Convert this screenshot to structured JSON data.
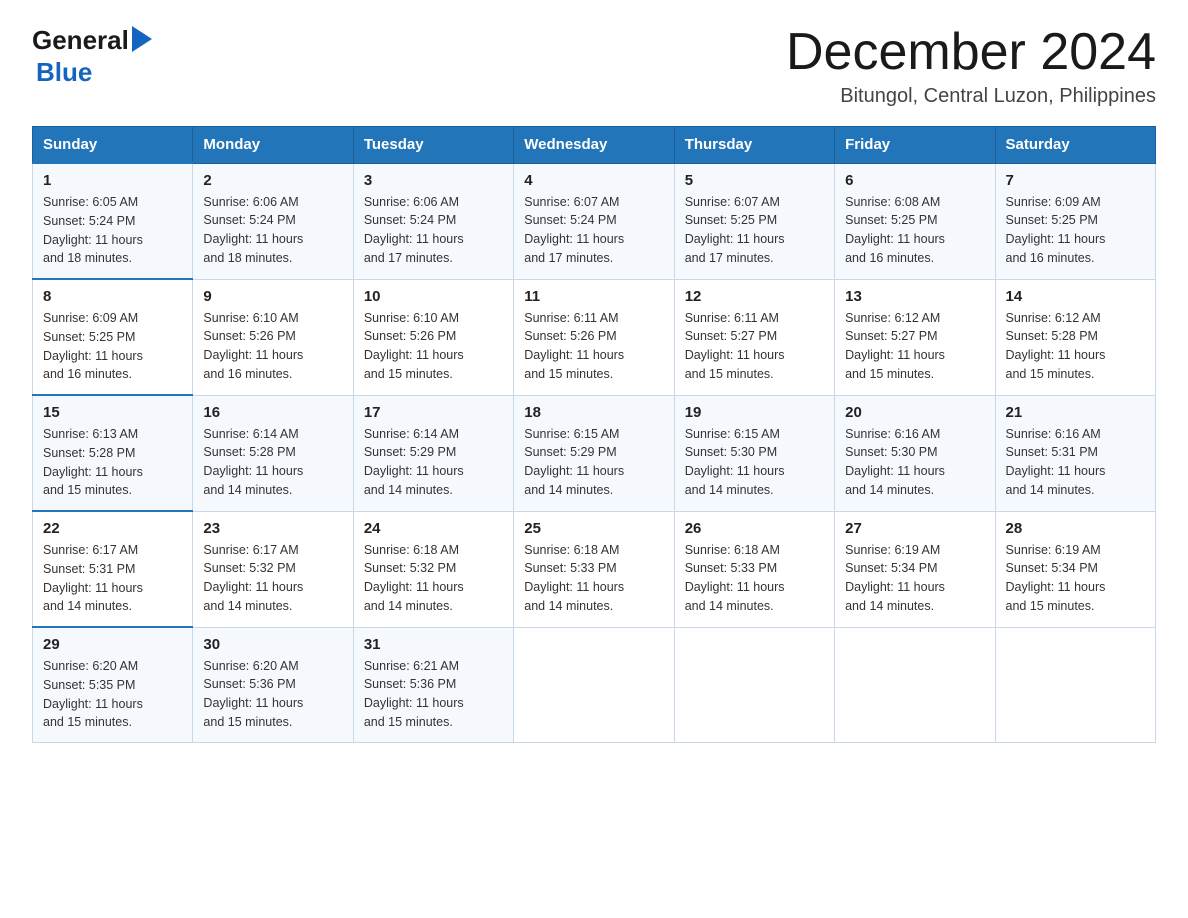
{
  "logo": {
    "general": "General",
    "blue": "Blue",
    "arrow": "▶"
  },
  "title": "December 2024",
  "location": "Bitungol, Central Luzon, Philippines",
  "days_of_week": [
    "Sunday",
    "Monday",
    "Tuesday",
    "Wednesday",
    "Thursday",
    "Friday",
    "Saturday"
  ],
  "weeks": [
    [
      {
        "day": "1",
        "sunrise": "6:05 AM",
        "sunset": "5:24 PM",
        "daylight": "11 hours and 18 minutes."
      },
      {
        "day": "2",
        "sunrise": "6:06 AM",
        "sunset": "5:24 PM",
        "daylight": "11 hours and 18 minutes."
      },
      {
        "day": "3",
        "sunrise": "6:06 AM",
        "sunset": "5:24 PM",
        "daylight": "11 hours and 17 minutes."
      },
      {
        "day": "4",
        "sunrise": "6:07 AM",
        "sunset": "5:24 PM",
        "daylight": "11 hours and 17 minutes."
      },
      {
        "day": "5",
        "sunrise": "6:07 AM",
        "sunset": "5:25 PM",
        "daylight": "11 hours and 17 minutes."
      },
      {
        "day": "6",
        "sunrise": "6:08 AM",
        "sunset": "5:25 PM",
        "daylight": "11 hours and 16 minutes."
      },
      {
        "day": "7",
        "sunrise": "6:09 AM",
        "sunset": "5:25 PM",
        "daylight": "11 hours and 16 minutes."
      }
    ],
    [
      {
        "day": "8",
        "sunrise": "6:09 AM",
        "sunset": "5:25 PM",
        "daylight": "11 hours and 16 minutes."
      },
      {
        "day": "9",
        "sunrise": "6:10 AM",
        "sunset": "5:26 PM",
        "daylight": "11 hours and 16 minutes."
      },
      {
        "day": "10",
        "sunrise": "6:10 AM",
        "sunset": "5:26 PM",
        "daylight": "11 hours and 15 minutes."
      },
      {
        "day": "11",
        "sunrise": "6:11 AM",
        "sunset": "5:26 PM",
        "daylight": "11 hours and 15 minutes."
      },
      {
        "day": "12",
        "sunrise": "6:11 AM",
        "sunset": "5:27 PM",
        "daylight": "11 hours and 15 minutes."
      },
      {
        "day": "13",
        "sunrise": "6:12 AM",
        "sunset": "5:27 PM",
        "daylight": "11 hours and 15 minutes."
      },
      {
        "day": "14",
        "sunrise": "6:12 AM",
        "sunset": "5:28 PM",
        "daylight": "11 hours and 15 minutes."
      }
    ],
    [
      {
        "day": "15",
        "sunrise": "6:13 AM",
        "sunset": "5:28 PM",
        "daylight": "11 hours and 15 minutes."
      },
      {
        "day": "16",
        "sunrise": "6:14 AM",
        "sunset": "5:28 PM",
        "daylight": "11 hours and 14 minutes."
      },
      {
        "day": "17",
        "sunrise": "6:14 AM",
        "sunset": "5:29 PM",
        "daylight": "11 hours and 14 minutes."
      },
      {
        "day": "18",
        "sunrise": "6:15 AM",
        "sunset": "5:29 PM",
        "daylight": "11 hours and 14 minutes."
      },
      {
        "day": "19",
        "sunrise": "6:15 AM",
        "sunset": "5:30 PM",
        "daylight": "11 hours and 14 minutes."
      },
      {
        "day": "20",
        "sunrise": "6:16 AM",
        "sunset": "5:30 PM",
        "daylight": "11 hours and 14 minutes."
      },
      {
        "day": "21",
        "sunrise": "6:16 AM",
        "sunset": "5:31 PM",
        "daylight": "11 hours and 14 minutes."
      }
    ],
    [
      {
        "day": "22",
        "sunrise": "6:17 AM",
        "sunset": "5:31 PM",
        "daylight": "11 hours and 14 minutes."
      },
      {
        "day": "23",
        "sunrise": "6:17 AM",
        "sunset": "5:32 PM",
        "daylight": "11 hours and 14 minutes."
      },
      {
        "day": "24",
        "sunrise": "6:18 AM",
        "sunset": "5:32 PM",
        "daylight": "11 hours and 14 minutes."
      },
      {
        "day": "25",
        "sunrise": "6:18 AM",
        "sunset": "5:33 PM",
        "daylight": "11 hours and 14 minutes."
      },
      {
        "day": "26",
        "sunrise": "6:18 AM",
        "sunset": "5:33 PM",
        "daylight": "11 hours and 14 minutes."
      },
      {
        "day": "27",
        "sunrise": "6:19 AM",
        "sunset": "5:34 PM",
        "daylight": "11 hours and 14 minutes."
      },
      {
        "day": "28",
        "sunrise": "6:19 AM",
        "sunset": "5:34 PM",
        "daylight": "11 hours and 15 minutes."
      }
    ],
    [
      {
        "day": "29",
        "sunrise": "6:20 AM",
        "sunset": "5:35 PM",
        "daylight": "11 hours and 15 minutes."
      },
      {
        "day": "30",
        "sunrise": "6:20 AM",
        "sunset": "5:36 PM",
        "daylight": "11 hours and 15 minutes."
      },
      {
        "day": "31",
        "sunrise": "6:21 AM",
        "sunset": "5:36 PM",
        "daylight": "11 hours and 15 minutes."
      },
      null,
      null,
      null,
      null
    ]
  ],
  "labels": {
    "sunrise": "Sunrise:",
    "sunset": "Sunset:",
    "daylight": "Daylight:"
  }
}
